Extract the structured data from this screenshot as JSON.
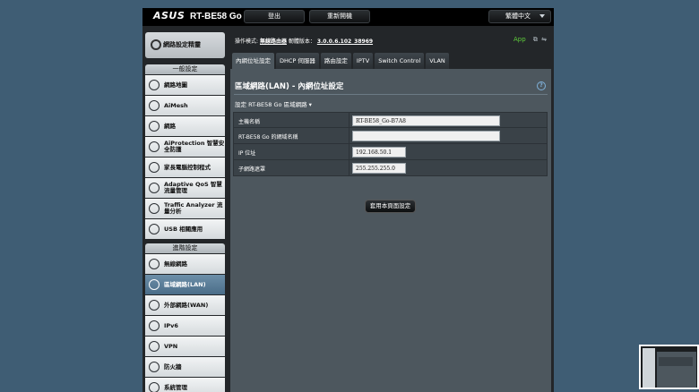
{
  "header": {
    "brand": "ASUS",
    "model": "RT-BE58 Go",
    "logout_label": "登出",
    "reboot_label": "重新開機",
    "language": "繁體中文"
  },
  "sidebar": {
    "top_item": "網路設定精靈",
    "general_section": "一般設定",
    "general_items": [
      {
        "label": "網路地圖",
        "icon": "globe-icon"
      },
      {
        "label": "AiMesh",
        "icon": "mesh-icon"
      },
      {
        "label": "網路",
        "icon": "network-icon"
      },
      {
        "label": "AiProtection 智慧安全防護",
        "icon": "shield-icon"
      },
      {
        "label": "家長電腦控制程式",
        "icon": "family-icon"
      },
      {
        "label": "Adaptive QoS 智慧流量管理",
        "icon": "qos-icon"
      },
      {
        "label": "Traffic Analyzer 流量分析",
        "icon": "analyzer-icon"
      },
      {
        "label": "USB 相關應用",
        "icon": "usb-icon"
      }
    ],
    "advanced_section": "進階設定",
    "advanced_items": [
      {
        "label": "無線網路",
        "icon": "wifi-icon"
      },
      {
        "label": "區域網路(LAN)",
        "icon": "lan-icon",
        "active": true
      },
      {
        "label": "外部網路(WAN)",
        "icon": "wan-icon"
      },
      {
        "label": "IPv6",
        "icon": "ipv6-icon"
      },
      {
        "label": "VPN",
        "icon": "vpn-icon"
      },
      {
        "label": "防火牆",
        "icon": "firewall-icon"
      },
      {
        "label": "系統管理",
        "icon": "admin-icon"
      }
    ]
  },
  "status": {
    "op_mode_label": "操作模式:",
    "op_mode_value": "無線路由器",
    "fw_label": "韌體版本：",
    "fw_value": "3.0.0.6.102_38969",
    "app_label": "App"
  },
  "tabs": [
    "內網位址設定",
    "DHCP 伺服器",
    "路由設定",
    "IPTV",
    "Switch Control",
    "VLAN"
  ],
  "panel": {
    "title": "區域網路(LAN) - 內網位址設定",
    "subtitle": "設定 RT-BE58 Go 區域網路 ▾",
    "fields": [
      {
        "label": "主機名稱",
        "value": "RT-BE58_Go-B7A8"
      },
      {
        "label": "RT-BE58 Go 的網域名稱",
        "value": ""
      },
      {
        "label": "IP 位址",
        "value": "192.168.50.1"
      },
      {
        "label": "子網路遮罩",
        "value": "255.255.255.0"
      }
    ],
    "apply_label": "套用本頁面設定"
  },
  "colors": {
    "accent_active": "#4a6d88",
    "background": "#3f5d74",
    "app_green": "#5ecb3a"
  }
}
